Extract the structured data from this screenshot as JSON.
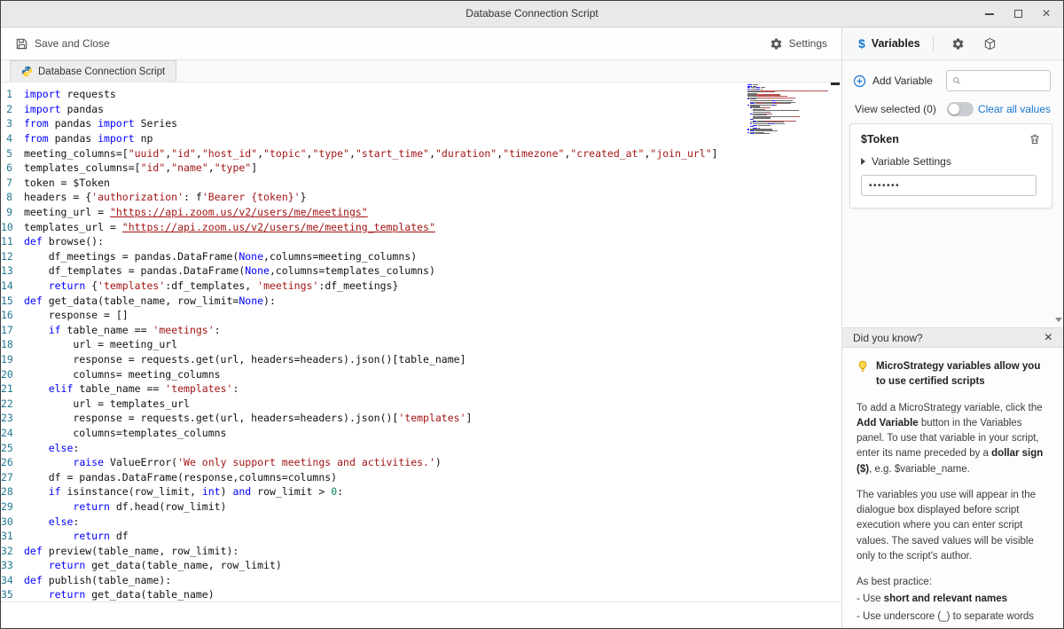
{
  "window": {
    "title": "Database Connection Script"
  },
  "toolbar": {
    "save_and_close": "Save and Close",
    "settings": "Settings"
  },
  "right_header": {
    "dollar": "$",
    "variables_tab": "Variables"
  },
  "tabs": {
    "active": "Database Connection Script"
  },
  "editor": {
    "lines": [
      [
        [
          "k",
          "import"
        ],
        [
          "t",
          " requests"
        ]
      ],
      [
        [
          "k",
          "import"
        ],
        [
          "t",
          " pandas"
        ]
      ],
      [
        [
          "k",
          "from"
        ],
        [
          "t",
          " pandas "
        ],
        [
          "k",
          "import"
        ],
        [
          "t",
          " Series"
        ]
      ],
      [
        [
          "k",
          "from"
        ],
        [
          "t",
          " pandas "
        ],
        [
          "k",
          "import"
        ],
        [
          "t",
          " np"
        ]
      ],
      [
        [
          "t",
          "meeting_columns=["
        ],
        [
          "s",
          "\"uuid\""
        ],
        [
          "t",
          ","
        ],
        [
          "s",
          "\"id\""
        ],
        [
          "t",
          ","
        ],
        [
          "s",
          "\"host_id\""
        ],
        [
          "t",
          ","
        ],
        [
          "s",
          "\"topic\""
        ],
        [
          "t",
          ","
        ],
        [
          "s",
          "\"type\""
        ],
        [
          "t",
          ","
        ],
        [
          "s",
          "\"start_time\""
        ],
        [
          "t",
          ","
        ],
        [
          "s",
          "\"duration\""
        ],
        [
          "t",
          ","
        ],
        [
          "s",
          "\"timezone\""
        ],
        [
          "t",
          ","
        ],
        [
          "s",
          "\"created_at\""
        ],
        [
          "t",
          ","
        ],
        [
          "s",
          "\"join_url\""
        ],
        [
          "t",
          "]"
        ]
      ],
      [
        [
          "t",
          "templates_columns=["
        ],
        [
          "s",
          "\"id\""
        ],
        [
          "t",
          ","
        ],
        [
          "s",
          "\"name\""
        ],
        [
          "t",
          ","
        ],
        [
          "s",
          "\"type\""
        ],
        [
          "t",
          "]"
        ]
      ],
      [
        [
          "t",
          "token = $Token"
        ]
      ],
      [
        [
          "t",
          "headers = {"
        ],
        [
          "s",
          "'authorization'"
        ],
        [
          "t",
          ": f"
        ],
        [
          "s",
          "'Bearer {token}'"
        ],
        [
          "t",
          "}"
        ]
      ],
      [
        [
          "t",
          "meeting_url = "
        ],
        [
          "u",
          "\"https://api.zoom.us/v2/users/me/meetings\""
        ]
      ],
      [
        [
          "t",
          "templates_url = "
        ],
        [
          "u",
          "\"https://api.zoom.us/v2/users/me/meeting_templates\""
        ]
      ],
      [
        [
          "k",
          "def"
        ],
        [
          "t",
          " browse():"
        ]
      ],
      [
        [
          "t",
          "    df_meetings = pandas.DataFrame("
        ],
        [
          "k",
          "None"
        ],
        [
          "t",
          ",columns=meeting_columns)"
        ]
      ],
      [
        [
          "t",
          "    df_templates = pandas.DataFrame("
        ],
        [
          "k",
          "None"
        ],
        [
          "t",
          ",columns=templates_columns)"
        ]
      ],
      [
        [
          "t",
          "    "
        ],
        [
          "k",
          "return"
        ],
        [
          "t",
          " {"
        ],
        [
          "s",
          "'templates'"
        ],
        [
          "t",
          ":df_templates, "
        ],
        [
          "s",
          "'meetings'"
        ],
        [
          "t",
          ":df_meetings}"
        ]
      ],
      [
        [
          "k",
          "def"
        ],
        [
          "t",
          " get_data(table_name, row_limit="
        ],
        [
          "k",
          "None"
        ],
        [
          "t",
          "):"
        ]
      ],
      [
        [
          "t",
          "    response = []"
        ]
      ],
      [
        [
          "t",
          "    "
        ],
        [
          "k",
          "if"
        ],
        [
          "t",
          " table_name == "
        ],
        [
          "s",
          "'meetings'"
        ],
        [
          "t",
          ":"
        ]
      ],
      [
        [
          "t",
          "        url = meeting_url"
        ]
      ],
      [
        [
          "t",
          "        response = requests.get(url, headers=headers).json()[table_name]"
        ]
      ],
      [
        [
          "t",
          "        columns= meeting_columns"
        ]
      ],
      [
        [
          "t",
          "    "
        ],
        [
          "k",
          "elif"
        ],
        [
          "t",
          " table_name == "
        ],
        [
          "s",
          "'templates'"
        ],
        [
          "t",
          ":"
        ]
      ],
      [
        [
          "t",
          "        url = templates_url"
        ]
      ],
      [
        [
          "t",
          "        response = requests.get(url, headers=headers).json()["
        ],
        [
          "s",
          "'templates'"
        ],
        [
          "t",
          "]"
        ]
      ],
      [
        [
          "t",
          "        columns=templates_columns"
        ]
      ],
      [
        [
          "t",
          "    "
        ],
        [
          "k",
          "else"
        ],
        [
          "t",
          ":"
        ]
      ],
      [
        [
          "t",
          "        "
        ],
        [
          "k",
          "raise"
        ],
        [
          "t",
          " ValueError("
        ],
        [
          "s",
          "'We only support meetings and activities.'"
        ],
        [
          "t",
          ")"
        ]
      ],
      [
        [
          "t",
          "    df = pandas.DataFrame(response,columns=columns)"
        ]
      ],
      [
        [
          "t",
          "    "
        ],
        [
          "k",
          "if"
        ],
        [
          "t",
          " isinstance(row_limit, "
        ],
        [
          "k",
          "int"
        ],
        [
          "t",
          ") "
        ],
        [
          "k",
          "and"
        ],
        [
          "t",
          " row_limit > "
        ],
        [
          "n",
          "0"
        ],
        [
          "t",
          ":"
        ]
      ],
      [
        [
          "t",
          "        "
        ],
        [
          "k",
          "return"
        ],
        [
          "t",
          " df.head(row_limit)"
        ]
      ],
      [
        [
          "t",
          "    "
        ],
        [
          "k",
          "else"
        ],
        [
          "t",
          ":"
        ]
      ],
      [
        [
          "t",
          "        "
        ],
        [
          "k",
          "return"
        ],
        [
          "t",
          " df"
        ]
      ],
      [
        [
          "k",
          "def"
        ],
        [
          "t",
          " preview(table_name, row_limit):"
        ]
      ],
      [
        [
          "t",
          "    "
        ],
        [
          "k",
          "return"
        ],
        [
          "t",
          " get_data(table_name, row_limit)"
        ]
      ],
      [
        [
          "k",
          "def"
        ],
        [
          "t",
          " publish(table_name):"
        ]
      ],
      [
        [
          "t",
          "    "
        ],
        [
          "k",
          "return"
        ],
        [
          "t",
          " get_data(table_name)"
        ]
      ]
    ]
  },
  "variables_panel": {
    "add_variable": "Add Variable",
    "search_placeholder": "",
    "view_selected": "View selected (0)",
    "clear_all": "Clear all values",
    "variable": {
      "name": "$Token",
      "settings": "Variable Settings",
      "masked_value": "•••••••"
    }
  },
  "did_you_know": {
    "title": "Did you know?",
    "headline": "MicroStrategy variables allow you to use certified scripts",
    "p1": [
      {
        "t": "To add a MicroStrategy variable, click the "
      },
      {
        "t": "Add Variable",
        "b": true
      },
      {
        "t": " button in the Variables panel. To use that variable in your script, enter its name preceded by a "
      },
      {
        "t": "dollar sign ($)",
        "b": true
      },
      {
        "t": ", e.g. $variable_name."
      }
    ],
    "p2": [
      {
        "t": "The variables you use will appear in the dialogue box displayed before script execution where you can enter script values. The saved values will be visible only to the script's author."
      }
    ],
    "best_practice_label": "As best practice:",
    "best_practices": [
      [
        {
          "t": "- Use "
        },
        {
          "t": "short and relevant names",
          "b": true
        }
      ],
      [
        {
          "t": "- Use underscore (_) to separate words"
        }
      ]
    ]
  },
  "icons": {
    "save": "floppy-icon",
    "settings": "gear-icon",
    "variables": "dollar-icon",
    "script_environment": "gear-icon",
    "packages": "package-icon",
    "tab_language": "python-icon",
    "add": "plus-circle-icon",
    "search": "magnifier-icon",
    "delete": "trash-icon",
    "expand": "chevron-right-icon",
    "tip": "lightbulb-icon",
    "close": "close-x-icon"
  },
  "colors": {
    "accent_blue": "#1976d2",
    "keyword": "#0000ff",
    "string": "#a31515",
    "number": "#098658",
    "line_number": "#237893",
    "python_blue": "#3572A5",
    "python_yellow": "#FFD43B"
  }
}
